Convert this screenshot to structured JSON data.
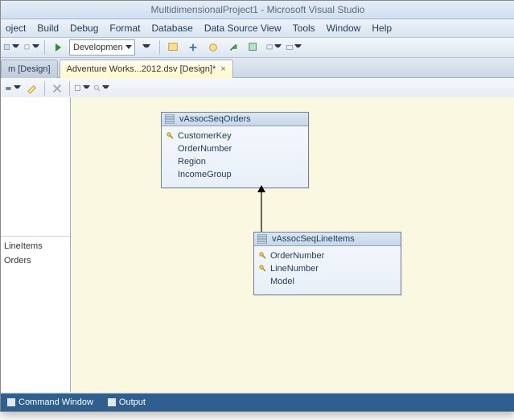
{
  "title": "MultidimensionalProject1 - Microsoft Visual Studio",
  "menu": [
    "oject",
    "Build",
    "Debug",
    "Format",
    "Database",
    "Data Source View",
    "Tools",
    "Window",
    "Help"
  ],
  "toolbar": {
    "config": "Developmen"
  },
  "tabs": {
    "inactive": "m [Design]",
    "active": "Adventure Works...2012.dsv [Design]*"
  },
  "side": {
    "top": "",
    "item1": "LineItems",
    "item2": "Orders"
  },
  "entity1": {
    "name": "vAssocSeqOrders",
    "cols": [
      "CustomerKey",
      "OrderNumber",
      "Region",
      "IncomeGroup"
    ],
    "keys": [
      true,
      false,
      false,
      false
    ]
  },
  "entity2": {
    "name": "vAssocSeqLineItems",
    "cols": [
      "OrderNumber",
      "LineNumber",
      "Model"
    ],
    "keys": [
      true,
      true,
      false
    ]
  },
  "status": {
    "a": "Command Window",
    "b": "Output"
  }
}
